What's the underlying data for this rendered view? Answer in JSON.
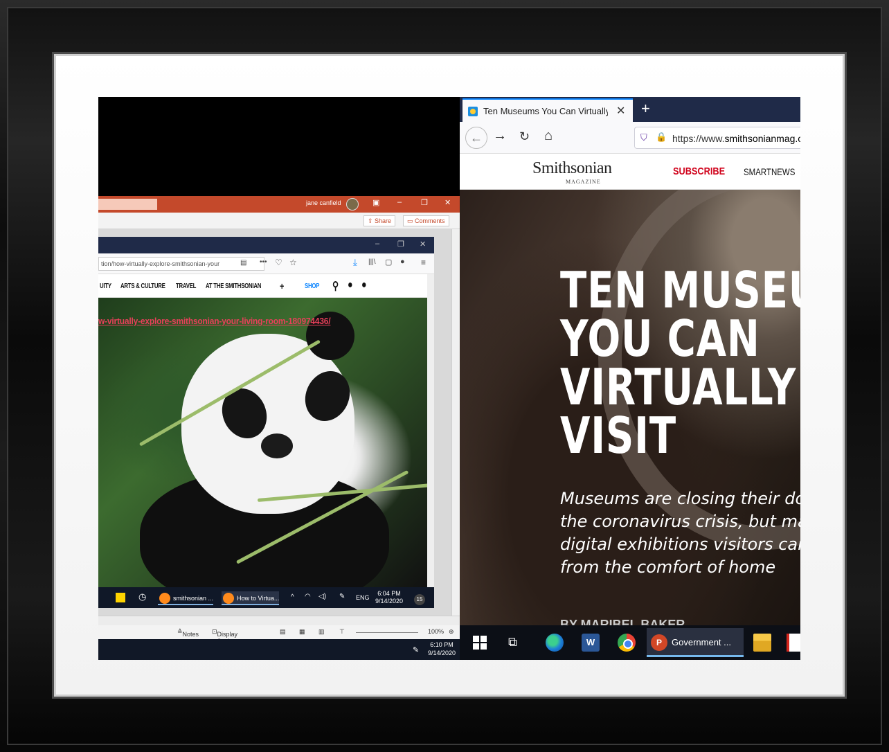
{
  "left_window": {
    "user_name": "jane canfield",
    "share_label": "Share",
    "comments_label": "Comments",
    "embedded_browser": {
      "url_fragment": "tion/how-virtually-explore-smithsonian-your",
      "nav_items": [
        "UITY",
        "ARTS & CULTURE",
        "TRAVEL",
        "AT THE SMITHSONIAN",
        "+",
        "SHOP"
      ],
      "link_text": "w-virtually-explore-smithsonian-your-living-room-180974436/",
      "taskbar_items": [
        "smithsonian ...",
        "How to Virtua..."
      ],
      "language": "ENG",
      "time": "6:04 PM",
      "date": "9/14/2020",
      "notification_count": "15"
    },
    "status_bar": {
      "notes_label": "Notes",
      "display_settings_label": "Display Settings",
      "zoom": "100%"
    },
    "taskbar_time": "6:10 PM",
    "taskbar_date": "9/14/2020"
  },
  "right_window": {
    "tab_title": "Ten Museums You Can Virtually Visit",
    "address_prefix": "https://www.",
    "address_domain": "smithsonianmag.com",
    "site": {
      "logo": "Smithsonian",
      "logo_sub": "MAGAZINE",
      "subscribe": "SUBSCRIBE",
      "smartnews": "SMARTNEWS"
    },
    "hero": {
      "title_lines": [
        "TEN MUSEUMS",
        "YOU CAN",
        "VIRTUALLY",
        "VISIT"
      ],
      "subtitle_lines": [
        "Museums are closing their doors amid",
        "the coronavirus crisis, but many offer",
        "digital exhibitions visitors can browse",
        "from the comfort of home"
      ],
      "byline": "BY MARIBEL BAKER"
    },
    "taskbar": {
      "active_app_label": "Government ..."
    }
  }
}
